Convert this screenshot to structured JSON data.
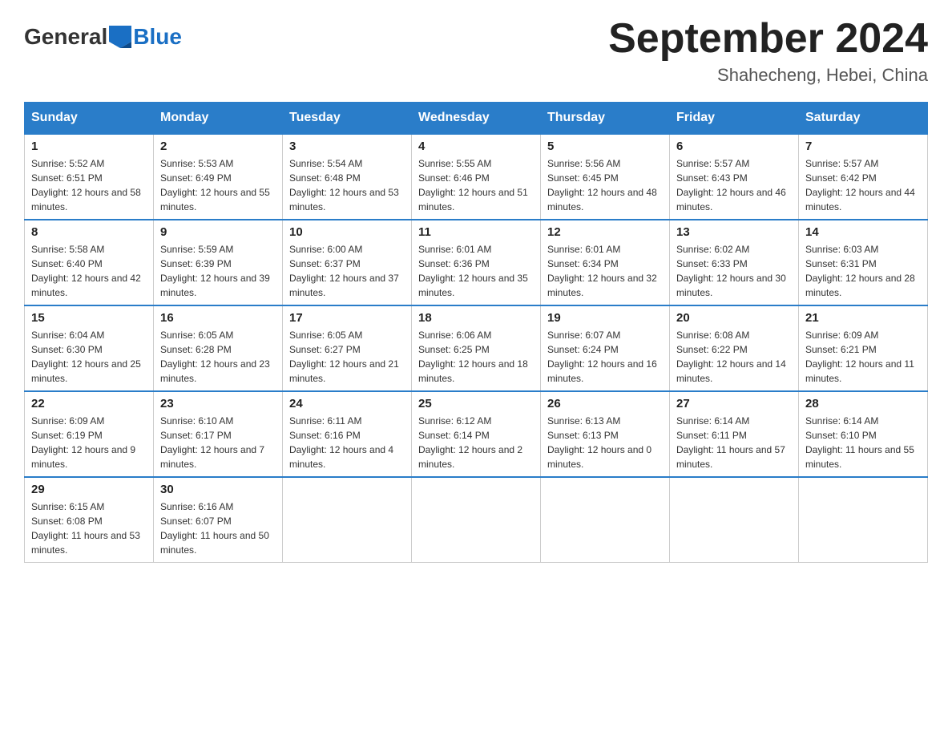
{
  "logo": {
    "text_general": "General",
    "text_blue": "Blue"
  },
  "title": "September 2024",
  "subtitle": "Shahecheng, Hebei, China",
  "weekdays": [
    "Sunday",
    "Monday",
    "Tuesday",
    "Wednesday",
    "Thursday",
    "Friday",
    "Saturday"
  ],
  "weeks": [
    [
      {
        "day": "1",
        "sunrise": "5:52 AM",
        "sunset": "6:51 PM",
        "daylight": "12 hours and 58 minutes."
      },
      {
        "day": "2",
        "sunrise": "5:53 AM",
        "sunset": "6:49 PM",
        "daylight": "12 hours and 55 minutes."
      },
      {
        "day": "3",
        "sunrise": "5:54 AM",
        "sunset": "6:48 PM",
        "daylight": "12 hours and 53 minutes."
      },
      {
        "day": "4",
        "sunrise": "5:55 AM",
        "sunset": "6:46 PM",
        "daylight": "12 hours and 51 minutes."
      },
      {
        "day": "5",
        "sunrise": "5:56 AM",
        "sunset": "6:45 PM",
        "daylight": "12 hours and 48 minutes."
      },
      {
        "day": "6",
        "sunrise": "5:57 AM",
        "sunset": "6:43 PM",
        "daylight": "12 hours and 46 minutes."
      },
      {
        "day": "7",
        "sunrise": "5:57 AM",
        "sunset": "6:42 PM",
        "daylight": "12 hours and 44 minutes."
      }
    ],
    [
      {
        "day": "8",
        "sunrise": "5:58 AM",
        "sunset": "6:40 PM",
        "daylight": "12 hours and 42 minutes."
      },
      {
        "day": "9",
        "sunrise": "5:59 AM",
        "sunset": "6:39 PM",
        "daylight": "12 hours and 39 minutes."
      },
      {
        "day": "10",
        "sunrise": "6:00 AM",
        "sunset": "6:37 PM",
        "daylight": "12 hours and 37 minutes."
      },
      {
        "day": "11",
        "sunrise": "6:01 AM",
        "sunset": "6:36 PM",
        "daylight": "12 hours and 35 minutes."
      },
      {
        "day": "12",
        "sunrise": "6:01 AM",
        "sunset": "6:34 PM",
        "daylight": "12 hours and 32 minutes."
      },
      {
        "day": "13",
        "sunrise": "6:02 AM",
        "sunset": "6:33 PM",
        "daylight": "12 hours and 30 minutes."
      },
      {
        "day": "14",
        "sunrise": "6:03 AM",
        "sunset": "6:31 PM",
        "daylight": "12 hours and 28 minutes."
      }
    ],
    [
      {
        "day": "15",
        "sunrise": "6:04 AM",
        "sunset": "6:30 PM",
        "daylight": "12 hours and 25 minutes."
      },
      {
        "day": "16",
        "sunrise": "6:05 AM",
        "sunset": "6:28 PM",
        "daylight": "12 hours and 23 minutes."
      },
      {
        "day": "17",
        "sunrise": "6:05 AM",
        "sunset": "6:27 PM",
        "daylight": "12 hours and 21 minutes."
      },
      {
        "day": "18",
        "sunrise": "6:06 AM",
        "sunset": "6:25 PM",
        "daylight": "12 hours and 18 minutes."
      },
      {
        "day": "19",
        "sunrise": "6:07 AM",
        "sunset": "6:24 PM",
        "daylight": "12 hours and 16 minutes."
      },
      {
        "day": "20",
        "sunrise": "6:08 AM",
        "sunset": "6:22 PM",
        "daylight": "12 hours and 14 minutes."
      },
      {
        "day": "21",
        "sunrise": "6:09 AM",
        "sunset": "6:21 PM",
        "daylight": "12 hours and 11 minutes."
      }
    ],
    [
      {
        "day": "22",
        "sunrise": "6:09 AM",
        "sunset": "6:19 PM",
        "daylight": "12 hours and 9 minutes."
      },
      {
        "day": "23",
        "sunrise": "6:10 AM",
        "sunset": "6:17 PM",
        "daylight": "12 hours and 7 minutes."
      },
      {
        "day": "24",
        "sunrise": "6:11 AM",
        "sunset": "6:16 PM",
        "daylight": "12 hours and 4 minutes."
      },
      {
        "day": "25",
        "sunrise": "6:12 AM",
        "sunset": "6:14 PM",
        "daylight": "12 hours and 2 minutes."
      },
      {
        "day": "26",
        "sunrise": "6:13 AM",
        "sunset": "6:13 PM",
        "daylight": "12 hours and 0 minutes."
      },
      {
        "day": "27",
        "sunrise": "6:14 AM",
        "sunset": "6:11 PM",
        "daylight": "11 hours and 57 minutes."
      },
      {
        "day": "28",
        "sunrise": "6:14 AM",
        "sunset": "6:10 PM",
        "daylight": "11 hours and 55 minutes."
      }
    ],
    [
      {
        "day": "29",
        "sunrise": "6:15 AM",
        "sunset": "6:08 PM",
        "daylight": "11 hours and 53 minutes."
      },
      {
        "day": "30",
        "sunrise": "6:16 AM",
        "sunset": "6:07 PM",
        "daylight": "11 hours and 50 minutes."
      },
      null,
      null,
      null,
      null,
      null
    ]
  ],
  "labels": {
    "sunrise_prefix": "Sunrise: ",
    "sunset_prefix": "Sunset: ",
    "daylight_prefix": "Daylight: "
  }
}
